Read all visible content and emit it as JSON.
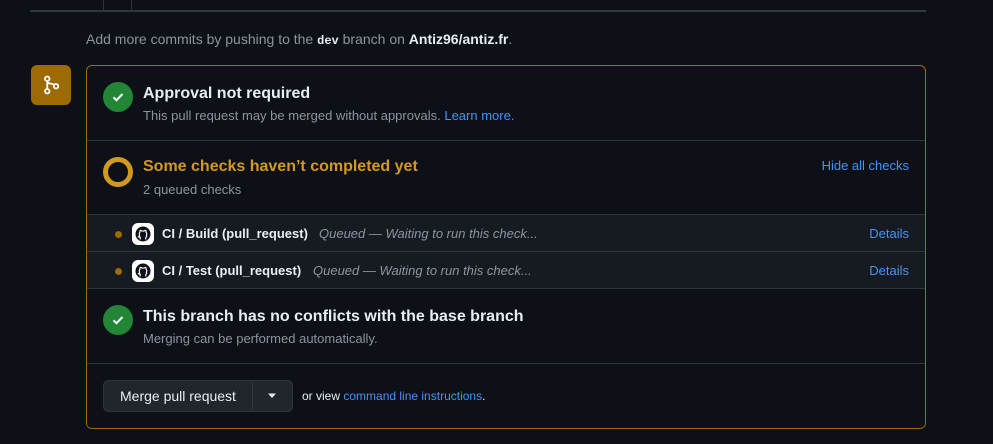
{
  "hint": {
    "prefix": "Add more commits by pushing to the",
    "branch": "dev",
    "middle": "branch on",
    "repo": "Antiz96/antiz.fr",
    "suffix": "."
  },
  "approval": {
    "title": "Approval not required",
    "subtitle": "This pull request may be merged without approvals.",
    "learn_more": "Learn more."
  },
  "checks": {
    "title": "Some checks haven’t completed yet",
    "subtitle": "2 queued checks",
    "toggle_label": "Hide all checks",
    "items": [
      {
        "name": "CI / Build (pull_request)",
        "status": "Queued — Waiting to run this check...",
        "details": "Details"
      },
      {
        "name": "CI / Test (pull_request)",
        "status": "Queued — Waiting to run this check...",
        "details": "Details"
      }
    ]
  },
  "conflicts": {
    "title": "This branch has no conflicts with the base branch",
    "subtitle": "Merging can be performed automatically."
  },
  "merge": {
    "button_label": "Merge pull request",
    "alt_prefix": "or view",
    "alt_link": "command line instructions",
    "alt_suffix": "."
  },
  "colors": {
    "success": "#238636",
    "pending": "#d29922",
    "link": "#4493f8",
    "border_pending": "#9e6a03"
  }
}
